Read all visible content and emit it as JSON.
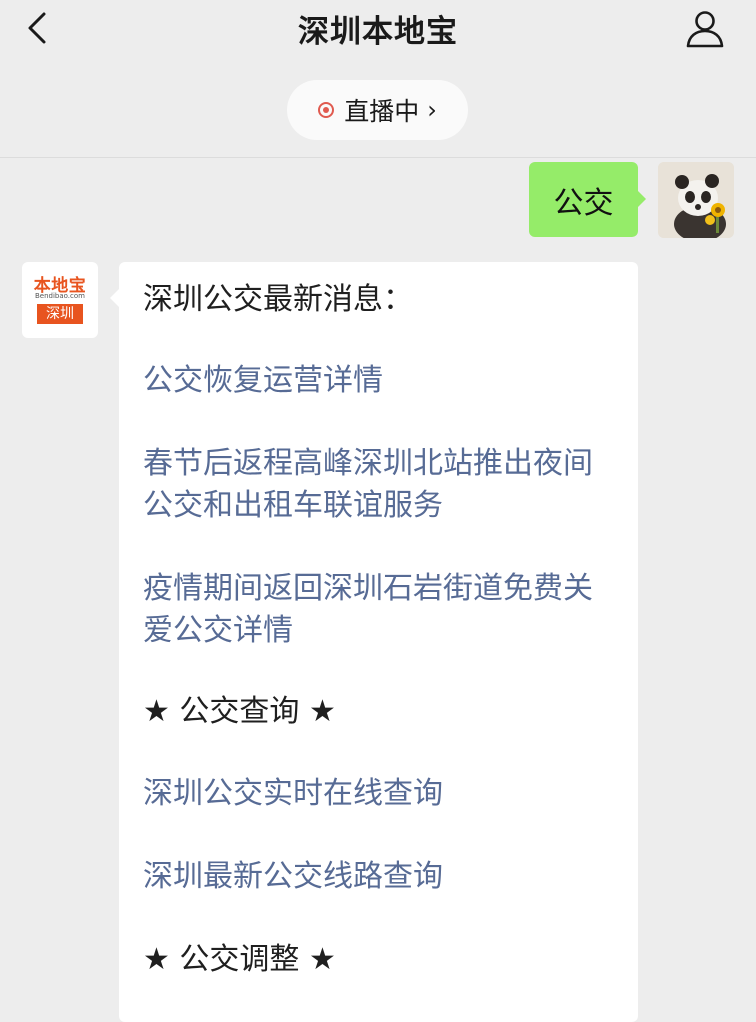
{
  "header": {
    "title": "深圳本地宝",
    "back_icon": "chevron-left-icon",
    "profile_icon": "user-icon"
  },
  "live": {
    "label": "直播中",
    "chevron": "›",
    "color": "#e05a4f"
  },
  "user_message": {
    "text": "公交"
  },
  "bot": {
    "logo_text": "本地宝",
    "logo_url": "Bendibao.com",
    "logo_city": "深圳",
    "accent": "#e8541f"
  },
  "bot_message": {
    "intro": "深圳公交最新消息：",
    "links_1": [
      "公交恢复运营详情",
      "春节后返程高峰深圳北站推出夜间公交和出租车联谊服务",
      "疫情期间返回深圳石岩街道免费关爱公交详情"
    ],
    "section_query": "★ 公交查询 ★",
    "links_2": [
      "深圳公交实时在线查询",
      "深圳最新公交线路查询"
    ],
    "section_adjust": "★ 公交调整 ★"
  },
  "colors": {
    "background": "#ededed",
    "bubble_green": "#95ec69",
    "link": "#576b95"
  }
}
